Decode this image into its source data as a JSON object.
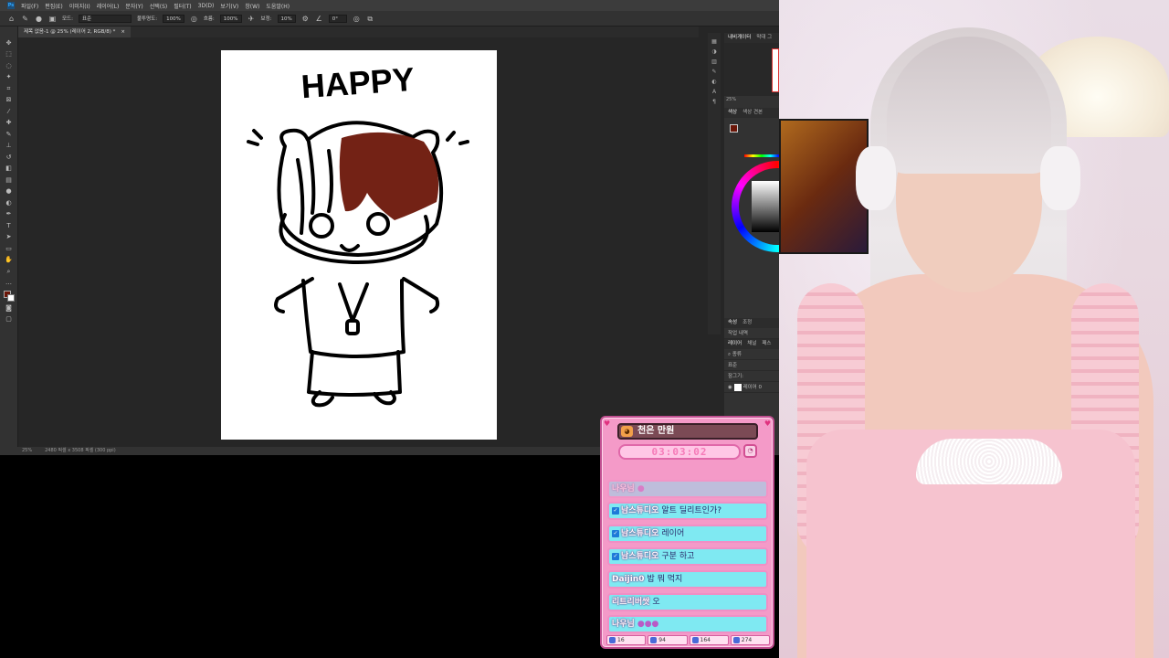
{
  "photoshop": {
    "menu": [
      "파일(F)",
      "편집(E)",
      "이미지(I)",
      "레이어(L)",
      "문자(Y)",
      "선택(S)",
      "필터(T)",
      "3D(D)",
      "보기(V)",
      "창(W)",
      "도움말(H)"
    ],
    "options": {
      "mode_label": "모드:",
      "mode_value": "표준",
      "opacity_label": "불투명도:",
      "opacity_value": "100%",
      "flow_label": "흐름:",
      "flow_value": "100%",
      "smoothing_label": "보정:",
      "smoothing_value": "10%",
      "angle_value": "0°"
    },
    "doc_tab": "제목 없음-1 @ 25% (레이어 2, RGB/8) *",
    "doc_tab_close": "×",
    "canvas_text": "HAPPY",
    "status_zoom": "25%",
    "status_info": "2480 픽셀 x 3508 픽셀 (300 ppi)",
    "panels": {
      "nav_tabs": [
        "내비게이터",
        "막대 그"
      ],
      "zoom": "25%",
      "color_tabs": [
        "색상",
        "색상 견본"
      ],
      "props_tabs": [
        "속성",
        "조정"
      ],
      "history_tab": "작업 내역",
      "layers_tabs": [
        "레이어",
        "채널",
        "패스"
      ],
      "layer_kind": "종류",
      "blend_mode": "표준",
      "lock_label": "잠그기:",
      "layer_name": "레이어 0"
    },
    "accent_brush_color": "#6b1608"
  },
  "chat": {
    "title": "천은 만원",
    "timer": "03:03:02",
    "messages": [
      {
        "nick": "나우님",
        "text": "",
        "emote": "●",
        "verified": false,
        "faded": true
      },
      {
        "nick": "남스튜디오",
        "text": "알트 딜리트인가?",
        "verified": true,
        "faded": false
      },
      {
        "nick": "남스튜디오",
        "text": "레이어",
        "verified": true,
        "faded": false
      },
      {
        "nick": "남스튜디오",
        "text": "구분 하고",
        "verified": true,
        "faded": false
      },
      {
        "nick": "Daijin0",
        "text": "밥 뭐 먹지",
        "verified": false,
        "faded": false
      },
      {
        "nick": "리트리버쌋",
        "text": "오",
        "verified": false,
        "faded": false
      },
      {
        "nick": "나우님",
        "text": "",
        "emote": "●●●",
        "verified": false,
        "faded": false
      }
    ],
    "stats": [
      "16",
      "94",
      "164",
      "274"
    ],
    "colors": {
      "frame": "#f49ac8",
      "bubble": "#7fe9f2",
      "timer_text": "#f67ab8"
    }
  }
}
